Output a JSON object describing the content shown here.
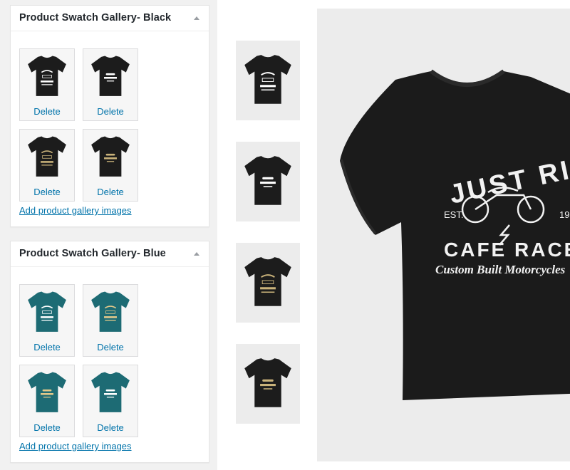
{
  "colors": {
    "link": "#0073aa",
    "shirt_black": "#1c1c1c",
    "shirt_blue": "#1d6b74"
  },
  "galleries": [
    {
      "title": "Product Swatch Gallery- Black",
      "thumbs": [
        {
          "delete_label": "Delete",
          "print": "Just Ride / Cafe Racer",
          "ink": "white"
        },
        {
          "delete_label": "Delete",
          "print": "T-Shirt Black",
          "ink": "white"
        },
        {
          "delete_label": "Delete",
          "print": "Just Ride / Cafe Racer",
          "ink": "gold"
        },
        {
          "delete_label": "Delete",
          "print": "T-Shirt Black",
          "ink": "gold"
        }
      ],
      "add_link": "Add product gallery images"
    },
    {
      "title": "Product Swatch Gallery- Blue",
      "thumbs": [
        {
          "delete_label": "Delete",
          "print": "Just Ride / Cafe Racer",
          "ink": "white"
        },
        {
          "delete_label": "Delete",
          "print": "Just Ride / Cafe Racer",
          "ink": "gold"
        },
        {
          "delete_label": "Delete",
          "print": "T-Shirt Black",
          "ink": "gold"
        },
        {
          "delete_label": "Delete",
          "print": "T-Shirt Black",
          "ink": "white"
        }
      ],
      "add_link": "Add product gallery images"
    }
  ],
  "product_preview": {
    "main_print": {
      "line1": "JUST RIDE",
      "est": "EST.",
      "year": "19",
      "line2": "CAFE RACER",
      "line3": "Custom Built Motorcycles"
    }
  }
}
